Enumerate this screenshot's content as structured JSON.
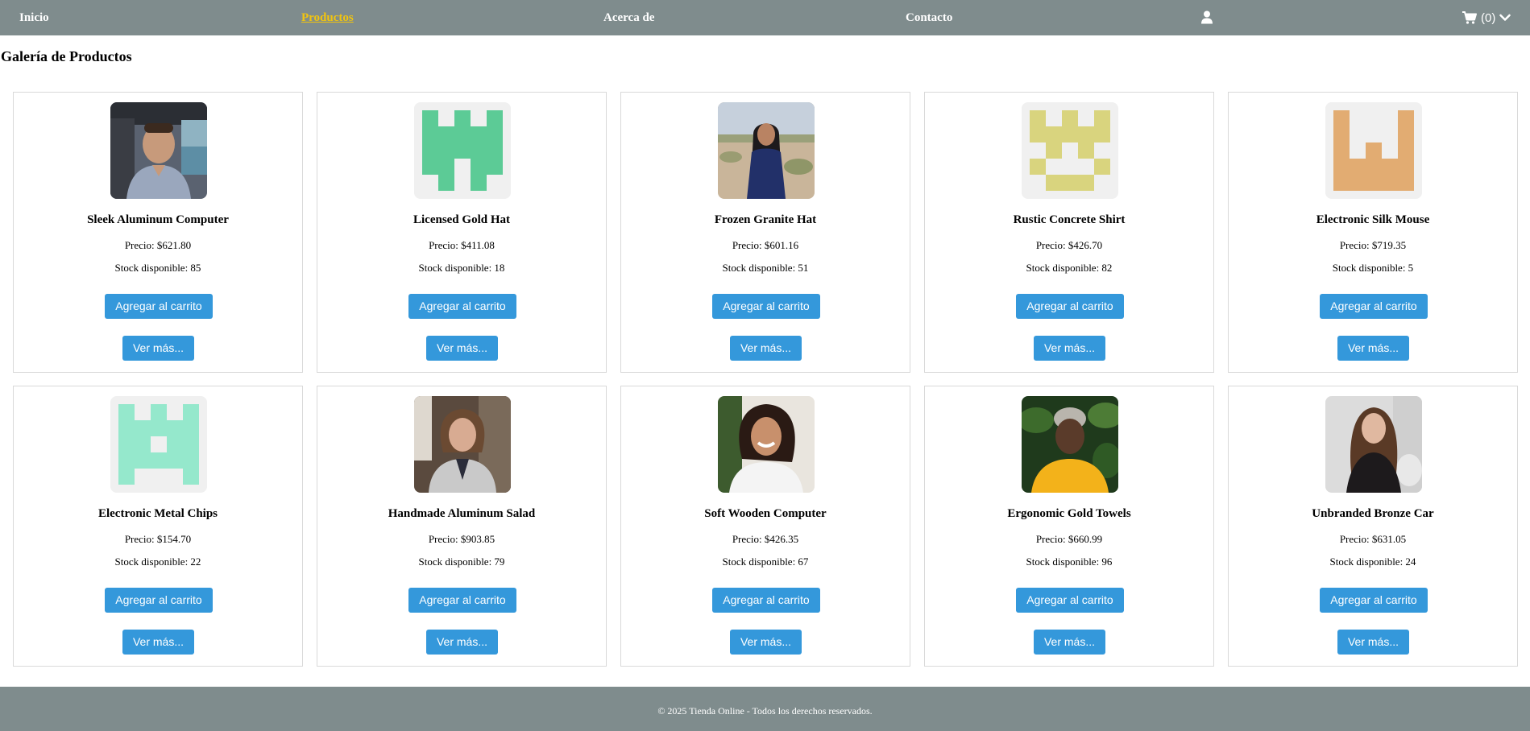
{
  "nav": {
    "items": [
      {
        "label": "Inicio",
        "active": false
      },
      {
        "label": "Productos",
        "active": true
      },
      {
        "label": "Acerca de",
        "active": false
      },
      {
        "label": "Contacto",
        "active": false
      }
    ],
    "user_icon": "user-icon",
    "cart_icon": "shopping-cart-icon",
    "cart_count": "(0)",
    "cart_chevron": "chevron-down-icon"
  },
  "page_title": "Galería de Productos",
  "products": [
    {
      "name": "Sleek Aluminum Computer",
      "price": "Precio: $621.80",
      "stock": "Stock disponible: 85",
      "add_label": "Agregar al carrito",
      "more_label": "Ver más...",
      "image": "photo-man-in-car"
    },
    {
      "name": "Licensed Gold Hat",
      "price": "Precio: $411.08",
      "stock": "Stock disponible: 18",
      "add_label": "Agregar al carrito",
      "more_label": "Ver más...",
      "image": "identicon-green"
    },
    {
      "name": "Frozen Granite Hat",
      "price": "Precio: $601.16",
      "stock": "Stock disponible: 51",
      "add_label": "Agregar al carrito",
      "more_label": "Ver más...",
      "image": "photo-woman-desert"
    },
    {
      "name": "Rustic Concrete Shirt",
      "price": "Precio: $426.70",
      "stock": "Stock disponible: 82",
      "add_label": "Agregar al carrito",
      "more_label": "Ver más...",
      "image": "identicon-yellow"
    },
    {
      "name": "Electronic Silk Mouse",
      "price": "Precio: $719.35",
      "stock": "Stock disponible: 5",
      "add_label": "Agregar al carrito",
      "more_label": "Ver más...",
      "image": "identicon-orange"
    },
    {
      "name": "Electronic Metal Chips",
      "price": "Precio: $154.70",
      "stock": "Stock disponible: 22",
      "add_label": "Agregar al carrito",
      "more_label": "Ver más...",
      "image": "identicon-mint"
    },
    {
      "name": "Handmade Aluminum Salad",
      "price": "Precio: $903.85",
      "stock": "Stock disponible: 79",
      "add_label": "Agregar al carrito",
      "more_label": "Ver más...",
      "image": "photo-woman-office"
    },
    {
      "name": "Soft Wooden Computer",
      "price": "Precio: $426.35",
      "stock": "Stock disponible: 67",
      "add_label": "Agregar al carrito",
      "more_label": "Ver más...",
      "image": "photo-woman-smiling"
    },
    {
      "name": "Ergonomic Gold Towels",
      "price": "Precio: $660.99",
      "stock": "Stock disponible: 96",
      "add_label": "Agregar al carrito",
      "more_label": "Ver más...",
      "image": "photo-elder-woman-garden"
    },
    {
      "name": "Unbranded Bronze Car",
      "price": "Precio: $631.05",
      "stock": "Stock disponible: 24",
      "add_label": "Agregar al carrito",
      "more_label": "Ver más...",
      "image": "photo-woman-lace-top"
    }
  ],
  "colors": {
    "nav_bg": "#7f8c8d",
    "active_link": "#f1c40f",
    "button": "#3498db",
    "identicon_green": "#5ccb96",
    "identicon_yellow": "#d9d47e",
    "identicon_orange": "#e2ac72",
    "identicon_mint": "#95e8cc"
  },
  "footer": {
    "text": "© 2025 Tienda Online - Todos los derechos reservados."
  }
}
